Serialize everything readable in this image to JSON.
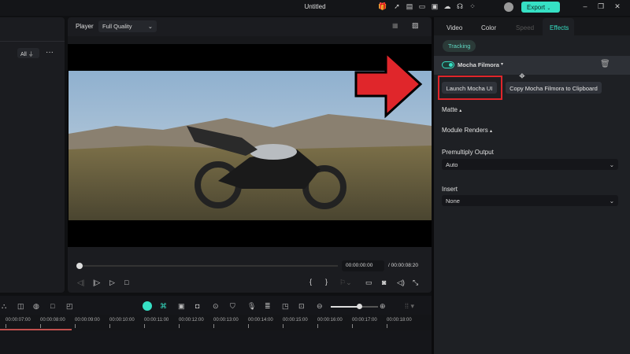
{
  "window": {
    "title": "Untitled",
    "export_label": "Export"
  },
  "left": {
    "filter_label": "All"
  },
  "player": {
    "label": "Player",
    "quality": "Full Quality",
    "current_time": "00:00:00:00",
    "total_time": "/ 00:00:08:20",
    "progress": 0
  },
  "right": {
    "tabs": [
      "Video",
      "Color",
      "Speed",
      "Effects"
    ],
    "active_tab": "Effects",
    "tracking_label": "Tracking",
    "effect_name": "Mocha Filmora",
    "effect_enabled": true,
    "launch_button": "Launch Mocha UI",
    "copy_button": "Copy Mocha Filmora to Clipboard",
    "matte_label": "Matte",
    "module_renders_label": "Module Renders",
    "premultiply_label": "Premultiply Output",
    "premultiply_value": "Auto",
    "insert_label": "Insert",
    "insert_value": "None"
  },
  "timeline": {
    "ticks": [
      "00:00:07:00",
      "00:00:08:00",
      "00:00:09:00",
      "00:00:10:00",
      "00:00:11:00",
      "00:00:12:00",
      "00:00:13:00",
      "00:00:14:00",
      "00:00:15:00",
      "00:00:16:00",
      "00:00:17:00",
      "00:00:18:00"
    ]
  },
  "colors": {
    "accent": "#36e0c4",
    "highlight": "#e0262b"
  }
}
